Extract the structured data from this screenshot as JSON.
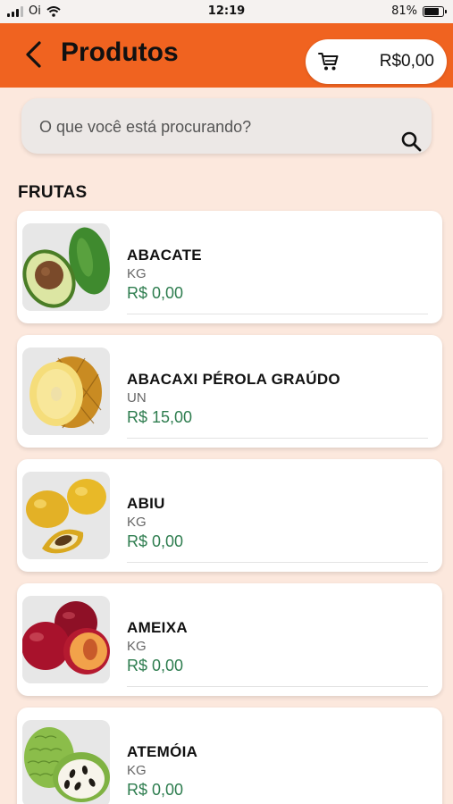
{
  "status_bar": {
    "carrier": "Oi",
    "time": "12:19",
    "battery": "81%",
    "battery_level": 0.81
  },
  "header": {
    "title": "Produtos",
    "cart_total": "R$0,00"
  },
  "search": {
    "placeholder": "O que você está procurando?"
  },
  "section": {
    "title": "FRUTAS"
  },
  "products": [
    {
      "name": "ABACATE",
      "unit": "KG",
      "price": "R$ 0,00",
      "image": "avocado"
    },
    {
      "name": "ABACAXI PÉROLA GRAÚDO",
      "unit": "UN",
      "price": "R$ 15,00",
      "image": "pineapple"
    },
    {
      "name": "ABIU",
      "unit": "KG",
      "price": "R$ 0,00",
      "image": "abiu"
    },
    {
      "name": "AMEIXA",
      "unit": "KG",
      "price": "R$ 0,00",
      "image": "plum"
    },
    {
      "name": "ATEMÓIA",
      "unit": "KG",
      "price": "R$ 0,00",
      "image": "atemoya"
    }
  ],
  "colors": {
    "header_bg": "#f06320",
    "page_bg": "#fce8dd",
    "price": "#2e7d4f"
  }
}
